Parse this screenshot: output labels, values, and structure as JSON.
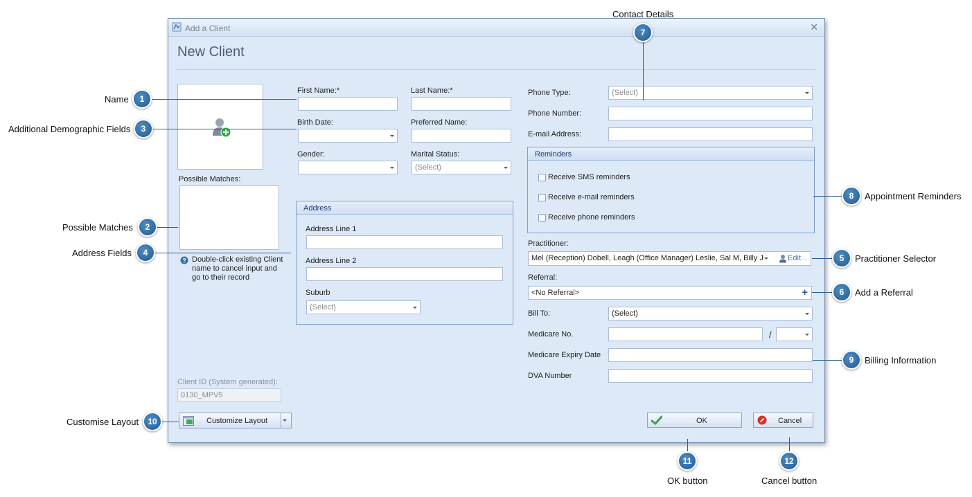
{
  "window": {
    "title": "Add a Client",
    "heading": "New Client"
  },
  "left": {
    "possible_matches_label": "Possible Matches:",
    "hint_text": "Double-click existing Client name to cancel input and go to their record",
    "client_id_label": "Client ID (System generated):",
    "client_id_value": "0130_MPV5",
    "customize_layout_label": "Customize Layout"
  },
  "demographics": {
    "first_name_label": "First Name:*",
    "last_name_label": "Last Name:*",
    "birth_date_label": "Birth Date:",
    "preferred_name_label": "Preferred Name:",
    "gender_label": "Gender:",
    "marital_status_label": "Marital Status:",
    "marital_status_value": "(Select)"
  },
  "address": {
    "panel_title": "Address",
    "line1_label": "Address Line 1",
    "line2_label": "Address Line 2",
    "suburb_label": "Suburb",
    "suburb_value": "(Select)"
  },
  "contact": {
    "phone_type_label": "Phone Type:",
    "phone_type_value": "(Select)",
    "phone_number_label": "Phone Number:",
    "email_label": "E-mail Address:"
  },
  "reminders": {
    "panel_title": "Reminders",
    "sms": "Receive SMS reminders",
    "email": "Receive e-mail reminders",
    "phone": "Receive phone reminders"
  },
  "practitioner": {
    "label": "Practitioner:",
    "value": "Mel (Reception) Dobell, Leagh (Office Manager) Leslie, Sal M, Billy J...",
    "edit_label": "Edit..."
  },
  "referral": {
    "label": "Referral:",
    "value": "<No Referral>",
    "add_symbol": "+"
  },
  "billing": {
    "bill_to_label": "Bill To:",
    "bill_to_value": "(Select)",
    "medicare_no_label": "Medicare No.",
    "slash": "/",
    "medicare_expiry_label": "Medicare Expiry Date",
    "dva_label": "DVA Number"
  },
  "buttons": {
    "ok": "OK",
    "cancel": "Cancel"
  },
  "callouts": {
    "c1": {
      "num": "1",
      "label": "Name"
    },
    "c2": {
      "num": "2",
      "label": "Possible Matches"
    },
    "c3": {
      "num": "3",
      "label": "Additional Demographic Fields"
    },
    "c4": {
      "num": "4",
      "label": "Address Fields"
    },
    "c5": {
      "num": "5",
      "label": "Practitioner Selector"
    },
    "c6": {
      "num": "6",
      "label": "Add a Referral"
    },
    "c7": {
      "num": "7",
      "label": "Contact Details"
    },
    "c8": {
      "num": "8",
      "label": "Appointment Reminders"
    },
    "c9": {
      "num": "9",
      "label": "Billing Information"
    },
    "c10": {
      "num": "10",
      "label": "Customise Layout"
    },
    "c11": {
      "num": "11",
      "label": "OK button"
    },
    "c12": {
      "num": "12",
      "label": "Cancel button"
    }
  },
  "colors": {
    "badge": "#2a6aa6",
    "window_bg": "#dde9f7",
    "panel_header_text": "#1e3c78"
  }
}
